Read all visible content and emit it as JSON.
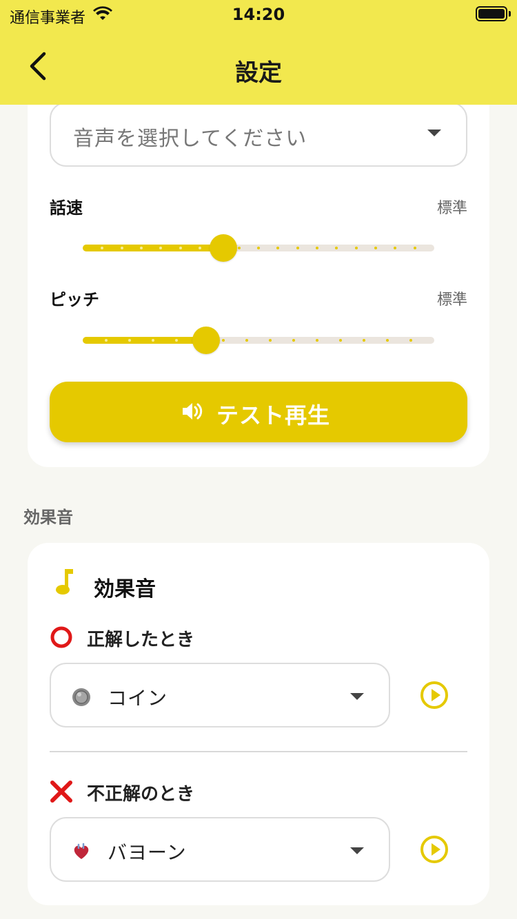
{
  "status_bar": {
    "carrier": "通信事業者",
    "time": "14:20"
  },
  "header": {
    "title": "設定"
  },
  "voice": {
    "select_placeholder": "音声を選択してください",
    "speed": {
      "label": "話速",
      "value_label": "標準",
      "level": 0.4
    },
    "pitch": {
      "label": "ピッチ",
      "value_label": "標準",
      "level": 0.35
    },
    "test_button_label": "テスト再生"
  },
  "sound_effects": {
    "section_title": "効果音",
    "card_title": "効果音",
    "correct": {
      "label": "正解したとき",
      "selected": "コイン"
    },
    "incorrect": {
      "label": "不正解のとき",
      "selected": "バヨーン"
    }
  },
  "colors": {
    "accent": "#e5c900",
    "header": "#f2e84e",
    "correct": "#e01818",
    "incorrect": "#e01818"
  }
}
